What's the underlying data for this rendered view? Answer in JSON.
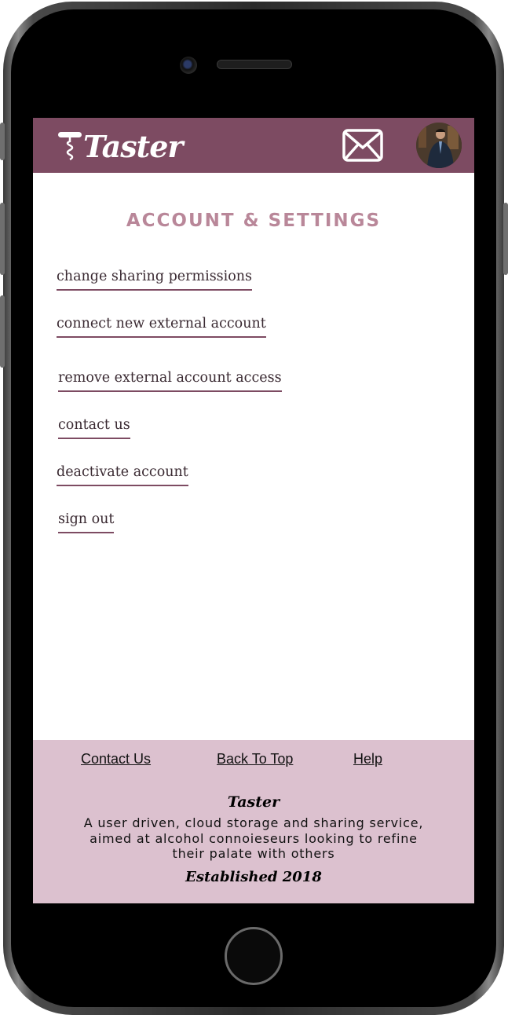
{
  "header": {
    "logo_text": "Taster",
    "mail_icon": "mail-icon",
    "avatar": "profile-avatar"
  },
  "main": {
    "title": "ACCOUNT & SETTINGS",
    "menu": [
      {
        "label": "change sharing permissions"
      },
      {
        "label": "connect new external account"
      },
      {
        "label": "remove external account access"
      },
      {
        "label": "contact us"
      },
      {
        "label": "deactivate account"
      },
      {
        "label": "sign out"
      }
    ]
  },
  "footer": {
    "links": [
      {
        "label": "Contact Us"
      },
      {
        "label": "Back To Top"
      },
      {
        "label": "Help"
      }
    ],
    "brand": "Taster",
    "tagline": "A user driven, cloud storage and sharing service, aimed at alcohol connoieseurs looking to refine their palate with others",
    "established": "Established 2018"
  },
  "colors": {
    "header_bg": "#7d4b62",
    "title": "#b98799",
    "footer_bg": "#dcc1cf",
    "underline": "#7d4b62"
  }
}
